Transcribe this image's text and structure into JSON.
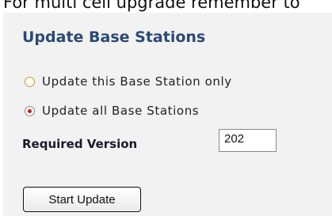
{
  "header": {
    "text": "For multi cell upgrade remember to"
  },
  "panel": {
    "title": "Update Base Stations",
    "options": [
      {
        "label": "Update this Base Station only",
        "selected": false
      },
      {
        "label": "Update all Base Stations",
        "selected": true
      }
    ],
    "required_version_label": "Required Version",
    "required_version_value": "202",
    "start_button_label": "Start Update"
  },
  "colors": {
    "title": "#2b4a75",
    "panel_background": "#f2f2f2",
    "radio_selected_dot": "#d01818"
  }
}
